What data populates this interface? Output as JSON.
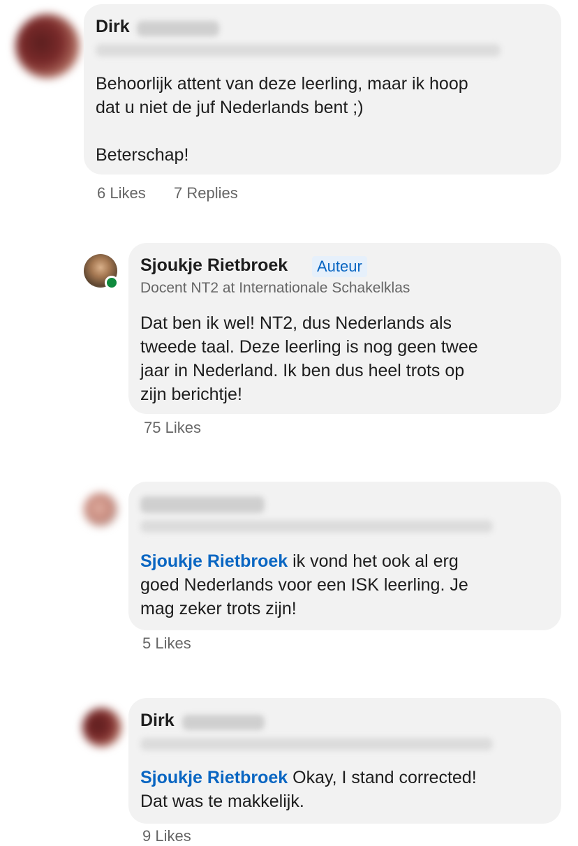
{
  "comments": [
    {
      "author_first": "Dirk",
      "text_lines": [
        "Behoorlijk attent van deze leerling, maar ik hoop",
        "dat u niet de juf Nederlands bent ;)",
        "",
        "Beterschap!"
      ],
      "likes": "6 Likes",
      "replies": "7 Replies"
    },
    {
      "author": "Sjoukje Rietbroek",
      "badge": "Auteur",
      "headline": "Docent NT2 at Internationale Schakelklas",
      "text_lines": [
        "Dat ben ik wel! NT2, dus Nederlands als",
        "tweede taal. Deze leerling is nog geen twee",
        "jaar in Nederland. Ik ben dus heel trots op",
        "zijn berichtje!"
      ],
      "likes": "75 Likes"
    },
    {
      "mention": "Sjoukje Rietbroek",
      "text_first": " ik vond het ook al erg",
      "text_lines": [
        "goed Nederlands voor een ISK leerling. Je",
        "mag zeker trots zijn!"
      ],
      "likes": "5 Likes"
    },
    {
      "author_first": "Dirk",
      "mention": "Sjoukje Rietbroek",
      "text_first": " Okay, I stand corrected!",
      "text_lines": [
        "Dat was te makkelijk."
      ],
      "likes": "9 Likes"
    }
  ],
  "colors": {
    "bubble": "#f2f2f2",
    "mention": "#0a66c2",
    "badge_bg": "#e6f0fb",
    "meta": "#666666"
  }
}
